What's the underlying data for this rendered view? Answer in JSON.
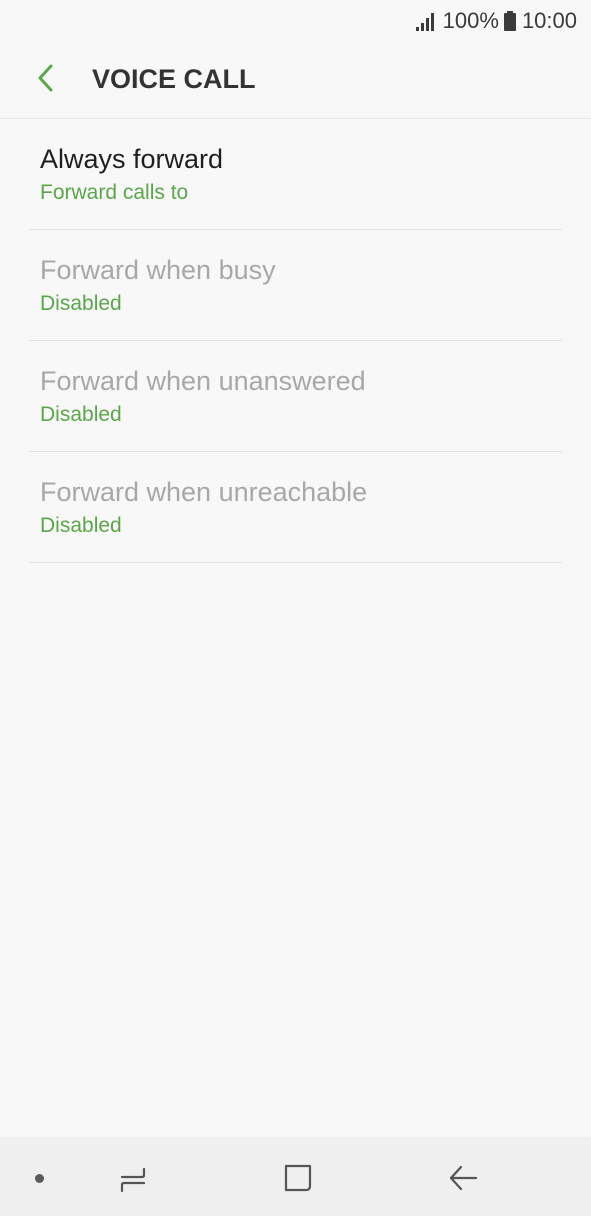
{
  "status_bar": {
    "battery_percent": "100%",
    "time": "10:00",
    "icons": [
      "signal-icon",
      "battery-icon"
    ]
  },
  "header": {
    "title": "VOICE CALL",
    "back_icon": "chevron-left-icon"
  },
  "items": [
    {
      "title": "Always forward",
      "subtitle": "Forward calls to",
      "enabled": true
    },
    {
      "title": "Forward when busy",
      "subtitle": "Disabled",
      "enabled": false
    },
    {
      "title": "Forward when unanswered",
      "subtitle": "Disabled",
      "enabled": false
    },
    {
      "title": "Forward when unreachable",
      "subtitle": "Disabled",
      "enabled": false
    }
  ],
  "nav_bar": {
    "icons": [
      "dot-icon",
      "recent-apps-icon",
      "home-icon",
      "back-arrow-icon"
    ]
  },
  "colors": {
    "accent": "#5aa64a",
    "background": "#f8f8f8",
    "title_text": "#1f1f1f",
    "disabled_text": "#a8a8a8",
    "header_text": "#333333",
    "nav_bar": "#efefef"
  }
}
